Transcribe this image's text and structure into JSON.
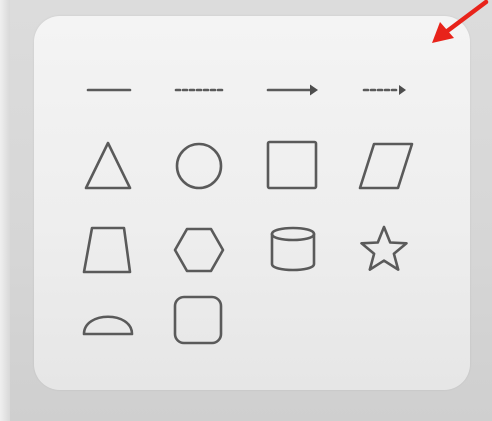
{
  "shape_panel": {
    "tools": [
      {
        "icon": "solid-line-icon"
      },
      {
        "icon": "dashed-line-icon"
      },
      {
        "icon": "solid-arrow-icon"
      },
      {
        "icon": "dashed-arrow-icon"
      },
      {
        "icon": "triangle-icon"
      },
      {
        "icon": "circle-icon"
      },
      {
        "icon": "square-icon"
      },
      {
        "icon": "parallelogram-icon"
      },
      {
        "icon": "trapezoid-icon"
      },
      {
        "icon": "hexagon-icon"
      },
      {
        "icon": "cylinder-icon"
      },
      {
        "icon": "star-icon"
      },
      {
        "icon": "half-circle-icon"
      },
      {
        "icon": "rounded-square-icon"
      }
    ]
  },
  "annotation": {
    "pointer_color": "#e8231a",
    "pointer_icon": "arrow-pointer-icon"
  },
  "colors": {
    "panel": "#f0f0f0",
    "backdrop": "#d8d8d8",
    "icon_stroke": "#5a5a5a"
  }
}
